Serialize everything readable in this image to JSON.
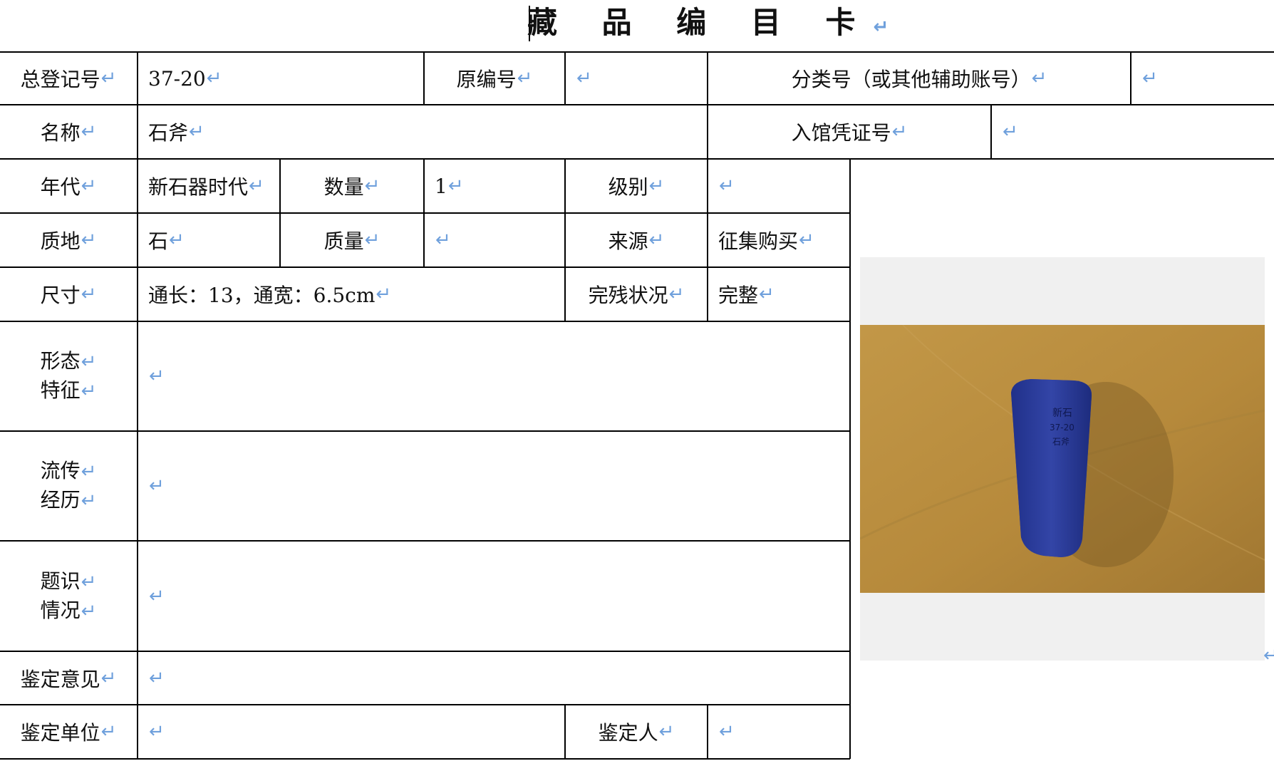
{
  "title": "藏 品 编 目 卡",
  "mark": "↵",
  "fields": {
    "reg_no_label": "总登记号",
    "reg_no_value": "37-20",
    "orig_no_label": "原编号",
    "orig_no_value": "",
    "class_no_label": "分类号（或其他辅助账号）",
    "class_no_value": "",
    "name_label": "名称",
    "name_value": "石斧",
    "voucher_label": "入馆凭证号",
    "voucher_value": "",
    "era_label": "年代",
    "era_value": "新石器时代",
    "qty_label": "数量",
    "qty_value": "1",
    "level_label": "级别",
    "level_value": "",
    "material_label": "质地",
    "material_value": "石",
    "mass_label": "质量",
    "mass_value": "",
    "source_label": "来源",
    "source_value": "征集购买",
    "size_label": "尺寸",
    "size_value": "通长：13，通宽：6.5cm",
    "condition_label": "完残状况",
    "condition_value": "完整",
    "form_label_1": "形态",
    "form_label_2": "特征",
    "form_value": "",
    "history_label_1": "流传",
    "history_label_2": "经历",
    "history_value": "",
    "inscription_label_1": "题识",
    "inscription_label_2": "情况",
    "inscription_value": "",
    "opinion_label": "鉴定意见",
    "opinion_value": "",
    "unit_label": "鉴定单位",
    "unit_value": "",
    "appraiser_label": "鉴定人",
    "appraiser_value": ""
  },
  "photo": {
    "inscription_lines": [
      "新石",
      "37-20",
      "石斧"
    ],
    "colors": {
      "artifact": "#2a3c9c",
      "background": "#b88838"
    }
  }
}
